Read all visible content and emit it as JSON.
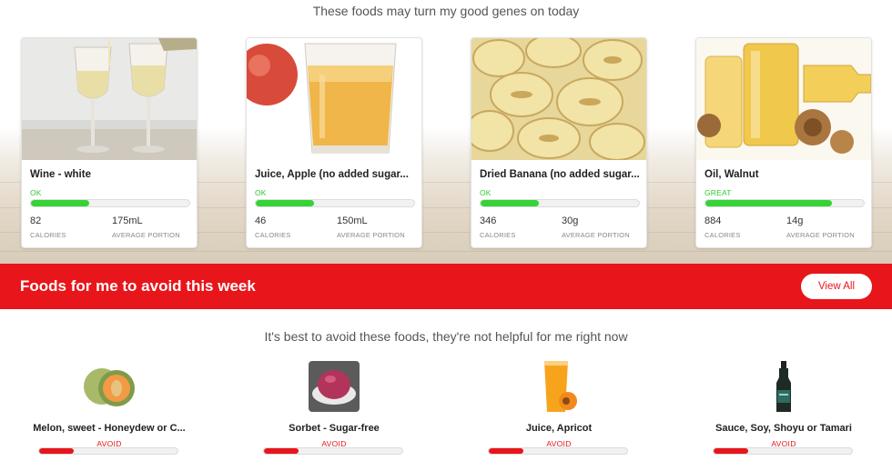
{
  "recommended": {
    "subtitle": "These foods may turn my good genes on today",
    "cards": [
      {
        "title": "Wine - white",
        "rating": "OK",
        "rating_fraction": 0.37,
        "calories": "82",
        "calories_label": "CALORIES",
        "portion": "175mL",
        "portion_label": "AVERAGE PORTION",
        "image": "white-wine-glasses"
      },
      {
        "title": "Juice, Apple (no added sugar...",
        "rating": "OK",
        "rating_fraction": 0.37,
        "calories": "46",
        "calories_label": "CALORIES",
        "portion": "150mL",
        "portion_label": "AVERAGE PORTION",
        "image": "apple-juice-glass"
      },
      {
        "title": "Dried Banana (no added sugar...",
        "rating": "OK",
        "rating_fraction": 0.37,
        "calories": "346",
        "calories_label": "CALORIES",
        "portion": "30g",
        "portion_label": "AVERAGE PORTION",
        "image": "banana-chips"
      },
      {
        "title": "Oil, Walnut",
        "rating": "GREAT",
        "rating_fraction": 0.8,
        "calories": "884",
        "calories_label": "CALORIES",
        "portion": "14g",
        "portion_label": "AVERAGE PORTION",
        "image": "walnut-oil-bottle"
      }
    ]
  },
  "avoid_banner": {
    "title": "Foods for me to avoid this week",
    "view_all_label": "View All"
  },
  "avoid": {
    "subtitle": "It's best to avoid these foods, they're not helpful for me right now",
    "items": [
      {
        "title": "Melon, sweet - Honeydew or C...",
        "label": "AVOID",
        "rating_fraction": 0.25,
        "image": "melon"
      },
      {
        "title": "Sorbet - Sugar-free",
        "label": "AVOID",
        "rating_fraction": 0.25,
        "image": "sorbet"
      },
      {
        "title": "Juice, Apricot",
        "label": "AVOID",
        "rating_fraction": 0.25,
        "image": "apricot-juice"
      },
      {
        "title": "Sauce, Soy, Shoyu or Tamari",
        "label": "AVOID",
        "rating_fraction": 0.25,
        "image": "soy-sauce-bottle"
      }
    ]
  },
  "colors": {
    "accent_red": "#e8151b",
    "ok_green": "#35d335"
  }
}
